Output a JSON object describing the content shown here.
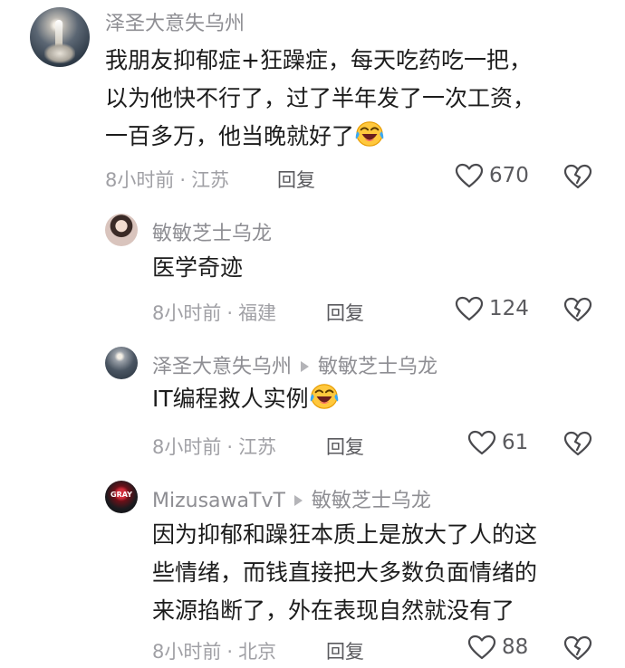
{
  "comments": [
    {
      "user": "泽圣大意失乌州",
      "reply_to": "",
      "text_lines": [
        "我朋友抑郁症+狂躁症，每天吃药吃一把，",
        "以为他快不行了，过了半年发了一次工资，",
        "一百多万，他当晚就好了"
      ],
      "emoji": "laughing-crying-emoji",
      "time": "8小时前",
      "location": "江苏",
      "reply_label": "回复",
      "likes": "670"
    },
    {
      "user": "敏敏芝士乌龙",
      "reply_to": "",
      "text_lines": [
        "医学奇迹"
      ],
      "time": "8小时前",
      "location": "福建",
      "reply_label": "回复",
      "likes": "124"
    },
    {
      "user": "泽圣大意失乌州",
      "reply_to": "敏敏芝士乌龙",
      "text_lines": [
        "IT编程救人实例"
      ],
      "emoji": "laughing-crying-emoji",
      "time": "8小时前",
      "location": "江苏",
      "reply_label": "回复",
      "likes": "61"
    },
    {
      "user": "MizusawaTvT",
      "reply_to": "敏敏芝士乌龙",
      "text_lines": [
        "因为抑郁和躁狂本质上是放大了人的这",
        "些情绪，而钱直接把大多数负面情绪的",
        "来源掐断了，外在表现自然就没有了"
      ],
      "time": "8小时前",
      "location": "北京",
      "reply_label": "回复",
      "likes": "88"
    }
  ],
  "avatar_text": "GRAY",
  "meta_separator": "·",
  "colors": {
    "name": "#8e8e93",
    "meta": "#a0a0a5",
    "text": "#1c1c1c"
  }
}
